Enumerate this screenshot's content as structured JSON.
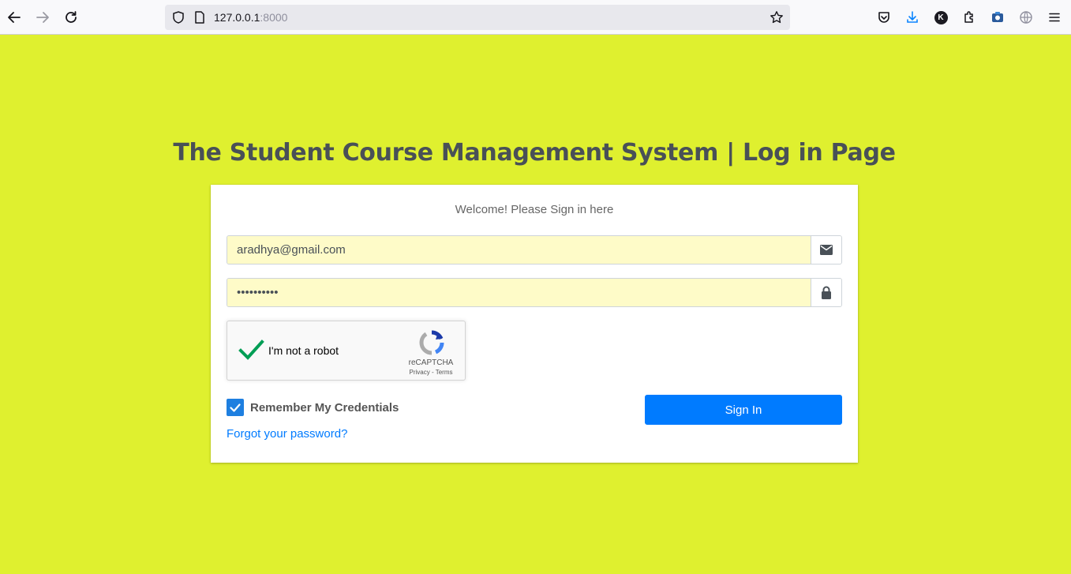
{
  "browser": {
    "url_host": "127.0.0.1",
    "url_port": ":8000",
    "k_avatar": "K"
  },
  "page": {
    "title": "The Student Course Management System | Log in Page",
    "background": "#dff02f"
  },
  "login_card": {
    "welcome": "Welcome! Please Sign in here",
    "email_value": "aradhya@gmail.com",
    "password_value": "••••••••••",
    "recaptcha": {
      "label": "I'm not a robot",
      "brand": "reCAPTCHA",
      "privacy": "Privacy",
      "terms": "Terms",
      "checked": true
    },
    "remember_label": "Remember My Credentials",
    "remember_checked": true,
    "forgot_link": "Forgot your password?",
    "signin_label": "Sign In",
    "accent": "#007bff"
  }
}
